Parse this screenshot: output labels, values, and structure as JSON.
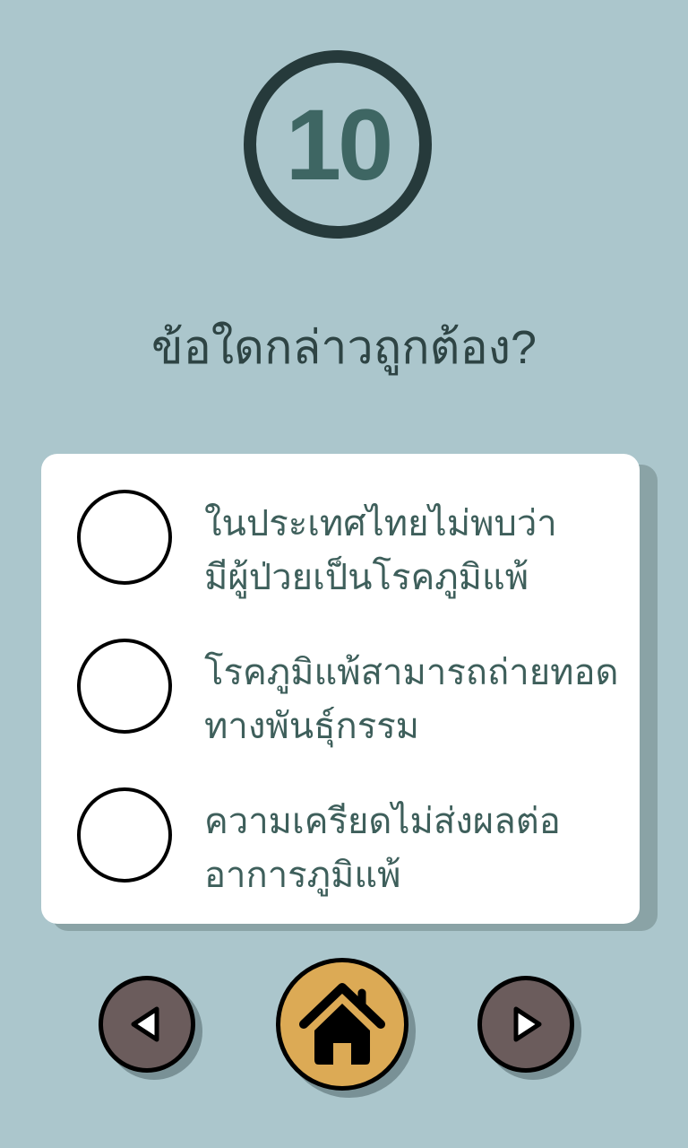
{
  "question_number": "10",
  "question": "ข้อใดกล่าวถูกต้อง?",
  "options": [
    {
      "label": "ในประเทศไทยไม่พบว่า\nมีผู้ป่วยเป็นโรคภูมิแพ้",
      "selected": false
    },
    {
      "label": "โรคภูมิแพ้สามารถถ่ายทอด\nทางพันธุ์กรรม",
      "selected": false
    },
    {
      "label": "ความเครียดไม่ส่งผลต่อ\nอาการภูมิแพ้",
      "selected": false
    }
  ],
  "nav": {
    "prev_icon": "triangle-left-icon",
    "home_icon": "home-icon",
    "next_icon": "triangle-right-icon"
  },
  "colors": {
    "background": "#abc6cc",
    "home": "#dcaa55",
    "nav": "#6b5c5c",
    "text": "#3e5f5b"
  }
}
